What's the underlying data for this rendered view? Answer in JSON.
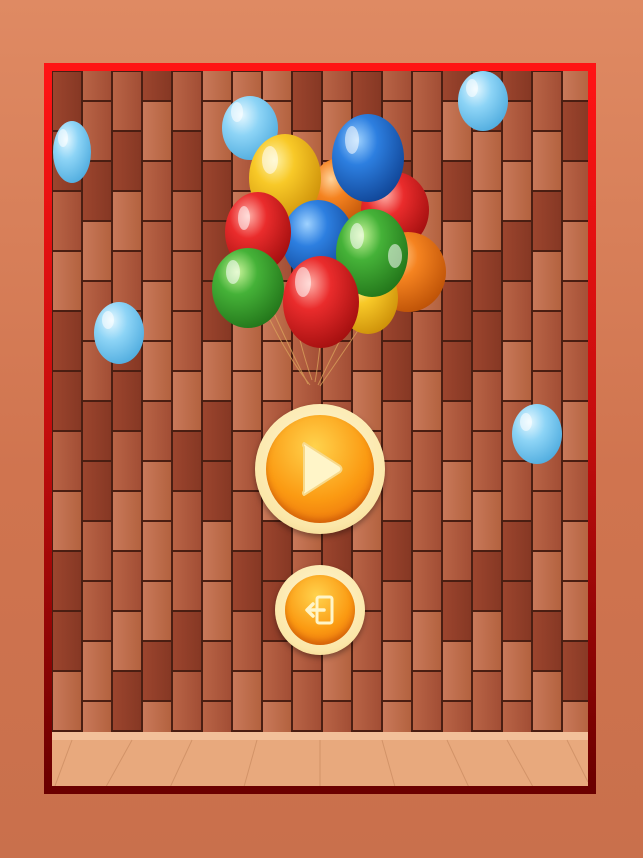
{
  "screen": {
    "name": "main-menu"
  },
  "buttons": {
    "play_icon": "play-icon",
    "exit_icon": "exit-door-icon"
  },
  "colors": {
    "frame_top": "#ff1414",
    "frame_bottom": "#6b0000",
    "button_orange": "#fb9a12",
    "button_ring": "#fbe7a8",
    "floor": "#e6a77c",
    "brick": "#a8553a"
  },
  "decor": {
    "balloon_colors": [
      "#f5c21a",
      "#1f6fd1",
      "#e8252b",
      "#3aa637",
      "#f07a1a",
      "#86d0f5"
    ]
  }
}
